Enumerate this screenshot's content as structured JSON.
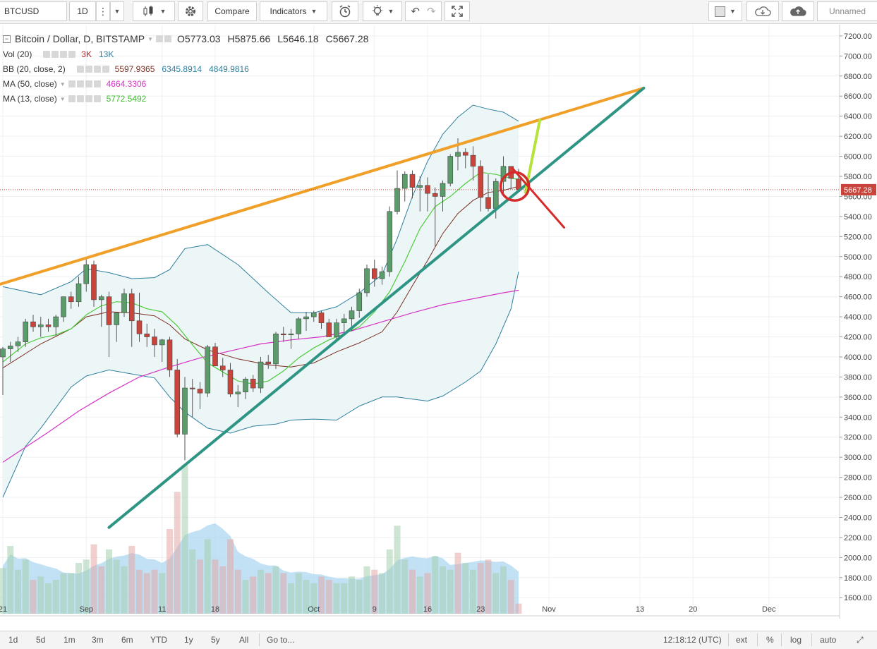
{
  "toolbar": {
    "symbol": "BTCUSD",
    "interval": "1D",
    "compare_label": "Compare",
    "indicators_label": "Indicators",
    "layout_name": "Unnamed",
    "icons": [
      "menu-dots-icon",
      "candles-icon",
      "gear-icon",
      "alert-clock-icon",
      "bulb-icon",
      "undo-icon",
      "redo-icon",
      "fullscreen-icon",
      "square-icon",
      "cloud-download-icon",
      "cloud-upload-icon"
    ]
  },
  "legend": {
    "title": "Bitcoin / Dollar, D, BITSTAMP",
    "ohlc": {
      "o": "O5773.03",
      "h": "H5875.66",
      "l": "L5646.18",
      "c": "C5667.28"
    },
    "vol": {
      "name": "Vol (20)",
      "v1": "3K",
      "v2": "13K"
    },
    "bb": {
      "name": "BB (20, close, 2)",
      "basis": "5597.9365",
      "upper": "6345.8914",
      "lower": "4849.9816"
    },
    "ma50": {
      "name": "MA (50, close)",
      "value": "4664.3306"
    },
    "ma13": {
      "name": "MA (13, close)",
      "value": "5772.5492"
    }
  },
  "colors": {
    "up": "#5b9c6b",
    "down": "#c9453c",
    "bb_line": "#2f7f9e",
    "bb_fill": "#eaf4f4",
    "ma50": "#d633c6",
    "ma13": "#4ccc3a",
    "basis": "#7a2e22",
    "orange_line": "#f0a028",
    "teal_line": "#2e9585",
    "lime_line": "#b5e33a",
    "marker": "#d62a2a",
    "last_price_tag": "#c9453c"
  },
  "chart_data": {
    "type": "candlestick",
    "title": "Bitcoin / Dollar, D, BITSTAMP",
    "ylim": [
      1420,
      7300
    ],
    "y_ticks": [
      "7200.00",
      "7000.00",
      "6800.00",
      "6600.00",
      "6400.00",
      "6200.00",
      "6000.00",
      "5800.00",
      "5600.00",
      "5400.00",
      "5200.00",
      "5000.00",
      "4800.00",
      "4600.00",
      "4400.00",
      "4200.00",
      "4000.00",
      "3800.00",
      "3600.00",
      "3400.00",
      "3200.00",
      "3000.00",
      "2800.00",
      "2600.00",
      "2400.00",
      "2200.00",
      "2000.00",
      "1800.00",
      "1600.00"
    ],
    "x_ticks": [
      {
        "label": "21",
        "day": 0
      },
      {
        "label": "Sep",
        "day": 11
      },
      {
        "label": "11",
        "day": 21
      },
      {
        "label": "18",
        "day": 28
      },
      {
        "label": "Oct",
        "day": 41
      },
      {
        "label": "9",
        "day": 49
      },
      {
        "label": "16",
        "day": 56
      },
      {
        "label": "23",
        "day": 63
      },
      {
        "label": "Nov",
        "day": 72
      },
      {
        "label": "13",
        "day": 84
      },
      {
        "label": "20",
        "day": 91
      },
      {
        "label": "Dec",
        "day": 101
      }
    ],
    "last_price": "5667.28",
    "last_price_value": 5667.28,
    "candles": [
      [
        4000,
        4100,
        3620,
        4080
      ],
      [
        4080,
        4150,
        3950,
        4110
      ],
      [
        4110,
        4200,
        4050,
        4150
      ],
      [
        4150,
        4380,
        4100,
        4350
      ],
      [
        4350,
        4420,
        4250,
        4300
      ],
      [
        4300,
        4400,
        4200,
        4320
      ],
      [
        4320,
        4380,
        4250,
        4300
      ],
      [
        4300,
        4420,
        4200,
        4400
      ],
      [
        4400,
        4600,
        4350,
        4600
      ],
      [
        4600,
        4650,
        4480,
        4550
      ],
      [
        4550,
        4800,
        4500,
        4730
      ],
      [
        4730,
        4990,
        4650,
        4920
      ],
      [
        4920,
        4960,
        4500,
        4570
      ],
      [
        4570,
        4620,
        4300,
        4600
      ],
      [
        4600,
        4650,
        4000,
        4320
      ],
      [
        4320,
        4450,
        4150,
        4440
      ],
      [
        4440,
        4680,
        4400,
        4630
      ],
      [
        4630,
        4680,
        4100,
        4360
      ],
      [
        4360,
        4640,
        4150,
        4230
      ],
      [
        4230,
        4330,
        4100,
        4200
      ],
      [
        4200,
        4280,
        4000,
        4120
      ],
      [
        4120,
        4180,
        3950,
        4170
      ],
      [
        4170,
        4200,
        3800,
        3870
      ],
      [
        3870,
        3980,
        3200,
        3230
      ],
      [
        3230,
        3800,
        2970,
        3690
      ],
      [
        3690,
        3780,
        3400,
        3680
      ],
      [
        3680,
        3750,
        3480,
        3640
      ],
      [
        3640,
        4120,
        3600,
        4100
      ],
      [
        4100,
        4140,
        3920,
        3910
      ],
      [
        3910,
        3990,
        3800,
        3870
      ],
      [
        3870,
        3940,
        3600,
        3630
      ],
      [
        3630,
        3720,
        3500,
        3650
      ],
      [
        3650,
        3800,
        3580,
        3780
      ],
      [
        3780,
        3820,
        3650,
        3690
      ],
      [
        3690,
        4000,
        3640,
        3950
      ],
      [
        3950,
        4020,
        3880,
        3930
      ],
      [
        3930,
        4250,
        3880,
        4230
      ],
      [
        4230,
        4300,
        4150,
        4220
      ],
      [
        4220,
        4280,
        4080,
        4230
      ],
      [
        4230,
        4400,
        4180,
        4380
      ],
      [
        4380,
        4450,
        4260,
        4400
      ],
      [
        4400,
        4460,
        4350,
        4440
      ],
      [
        4440,
        4460,
        4280,
        4340
      ],
      [
        4340,
        4380,
        4200,
        4200
      ],
      [
        4200,
        4380,
        4150,
        4340
      ],
      [
        4340,
        4430,
        4250,
        4380
      ],
      [
        4380,
        4500,
        4260,
        4460
      ],
      [
        4460,
        4680,
        4390,
        4640
      ],
      [
        4640,
        4920,
        4600,
        4880
      ],
      [
        4880,
        4970,
        4700,
        4780
      ],
      [
        4780,
        4900,
        4720,
        4850
      ],
      [
        4850,
        5500,
        4800,
        5450
      ],
      [
        5450,
        5860,
        5420,
        5680
      ],
      [
        5680,
        5850,
        5550,
        5820
      ],
      [
        5820,
        5860,
        5580,
        5690
      ],
      [
        5690,
        5800,
        5450,
        5710
      ],
      [
        5710,
        5790,
        5450,
        5630
      ],
      [
        5630,
        5690,
        5100,
        5600
      ],
      [
        5600,
        5760,
        5450,
        5730
      ],
      [
        5730,
        6020,
        5700,
        6000
      ],
      [
        6000,
        6180,
        5860,
        6040
      ],
      [
        6040,
        6080,
        5880,
        6010
      ],
      [
        6010,
        6100,
        5760,
        5900
      ],
      [
        5900,
        5960,
        5450,
        5590
      ],
      [
        5590,
        5820,
        5450,
        5480
      ],
      [
        5480,
        5780,
        5380,
        5750
      ],
      [
        5750,
        6000,
        5620,
        5900
      ],
      [
        5900,
        5900,
        5670,
        5780
      ],
      [
        5773.03,
        5875.66,
        5646.18,
        5667.28
      ]
    ],
    "volumes": [
      [
        1.35,
        "up"
      ],
      [
        2.0,
        "up"
      ],
      [
        1.3,
        "up"
      ],
      [
        1.6,
        "up"
      ],
      [
        1.0,
        "down"
      ],
      [
        1.1,
        "up"
      ],
      [
        0.9,
        "up"
      ],
      [
        1.0,
        "up"
      ],
      [
        1.2,
        "up"
      ],
      [
        1.2,
        "up"
      ],
      [
        1.5,
        "up"
      ],
      [
        1.6,
        "up"
      ],
      [
        2.05,
        "down"
      ],
      [
        1.4,
        "down"
      ],
      [
        1.9,
        "up"
      ],
      [
        1.6,
        "up"
      ],
      [
        1.4,
        "up"
      ],
      [
        2.0,
        "down"
      ],
      [
        1.3,
        "down"
      ],
      [
        1.2,
        "down"
      ],
      [
        1.3,
        "down"
      ],
      [
        1.2,
        "up"
      ],
      [
        2.5,
        "down"
      ],
      [
        3.6,
        "down"
      ],
      [
        4.4,
        "up"
      ],
      [
        1.9,
        "up"
      ],
      [
        1.6,
        "down"
      ],
      [
        2.2,
        "up"
      ],
      [
        1.6,
        "down"
      ],
      [
        1.4,
        "down"
      ],
      [
        2.2,
        "down"
      ],
      [
        1.3,
        "down"
      ],
      [
        1.0,
        "up"
      ],
      [
        1.1,
        "down"
      ],
      [
        1.3,
        "up"
      ],
      [
        1.2,
        "down"
      ],
      [
        1.4,
        "up"
      ],
      [
        1.2,
        "down"
      ],
      [
        0.9,
        "up"
      ],
      [
        1.2,
        "up"
      ],
      [
        1.0,
        "up"
      ],
      [
        0.9,
        "up"
      ],
      [
        1.1,
        "down"
      ],
      [
        1.0,
        "down"
      ],
      [
        0.9,
        "up"
      ],
      [
        0.9,
        "up"
      ],
      [
        1.1,
        "up"
      ],
      [
        1.0,
        "up"
      ],
      [
        1.4,
        "up"
      ],
      [
        1.3,
        "down"
      ],
      [
        1.2,
        "up"
      ],
      [
        1.9,
        "up"
      ],
      [
        2.6,
        "up"
      ],
      [
        1.6,
        "up"
      ],
      [
        1.3,
        "down"
      ],
      [
        1.1,
        "up"
      ],
      [
        1.2,
        "down"
      ],
      [
        1.7,
        "up"
      ],
      [
        1.4,
        "up"
      ],
      [
        1.3,
        "up"
      ],
      [
        1.8,
        "down"
      ],
      [
        1.5,
        "up"
      ],
      [
        1.3,
        "up"
      ],
      [
        1.5,
        "down"
      ],
      [
        1.6,
        "down"
      ],
      [
        1.2,
        "up"
      ],
      [
        1.4,
        "up"
      ],
      [
        1.0,
        "down"
      ],
      [
        0.3,
        "down"
      ]
    ],
    "bollinger": {
      "upper": [
        [
          0,
          4700
        ],
        [
          5,
          4620
        ],
        [
          9,
          4750
        ],
        [
          11,
          4880
        ],
        [
          14,
          4840
        ],
        [
          17,
          4780
        ],
        [
          20,
          4790
        ],
        [
          22,
          4870
        ],
        [
          24,
          5080
        ],
        [
          27,
          5120
        ],
        [
          31,
          4920
        ],
        [
          35,
          4640
        ],
        [
          38,
          4440
        ],
        [
          41,
          4440
        ],
        [
          44,
          4500
        ],
        [
          47,
          4640
        ],
        [
          50,
          4820
        ],
        [
          52,
          5180
        ],
        [
          54,
          5600
        ],
        [
          56,
          5950
        ],
        [
          58,
          6220
        ],
        [
          60,
          6390
        ],
        [
          62,
          6510
        ],
        [
          64,
          6470
        ],
        [
          66,
          6440
        ],
        [
          68,
          6350
        ]
      ],
      "basis": [
        [
          0,
          3890
        ],
        [
          5,
          4130
        ],
        [
          9,
          4280
        ],
        [
          11,
          4400
        ],
        [
          14,
          4450
        ],
        [
          17,
          4440
        ],
        [
          20,
          4410
        ],
        [
          22,
          4320
        ],
        [
          24,
          4180
        ],
        [
          27,
          4070
        ],
        [
          31,
          3980
        ],
        [
          35,
          3920
        ],
        [
          38,
          3900
        ],
        [
          41,
          3940
        ],
        [
          44,
          4050
        ],
        [
          47,
          4140
        ],
        [
          50,
          4250
        ],
        [
          52,
          4450
        ],
        [
          54,
          4710
        ],
        [
          56,
          4960
        ],
        [
          58,
          5230
        ],
        [
          60,
          5430
        ],
        [
          62,
          5560
        ],
        [
          64,
          5640
        ],
        [
          66,
          5660
        ],
        [
          68,
          5700
        ]
      ],
      "lower": [
        [
          0,
          2600
        ],
        [
          3,
          3110
        ],
        [
          5,
          3290
        ],
        [
          9,
          3700
        ],
        [
          11,
          3810
        ],
        [
          14,
          3870
        ],
        [
          17,
          3830
        ],
        [
          20,
          3790
        ],
        [
          22,
          3600
        ],
        [
          24,
          3450
        ],
        [
          27,
          3290
        ],
        [
          30,
          3240
        ],
        [
          33,
          3310
        ],
        [
          36,
          3330
        ],
        [
          38,
          3370
        ],
        [
          41,
          3380
        ],
        [
          44,
          3370
        ],
        [
          47,
          3510
        ],
        [
          50,
          3600
        ],
        [
          52,
          3600
        ],
        [
          54,
          3580
        ],
        [
          56,
          3560
        ],
        [
          58,
          3610
        ],
        [
          61,
          3750
        ],
        [
          63,
          3860
        ],
        [
          65,
          4130
        ],
        [
          67,
          4480
        ],
        [
          68,
          4850
        ]
      ]
    },
    "ma13": [
      [
        0,
        3950
      ],
      [
        3,
        4130
      ],
      [
        5,
        4190
      ],
      [
        7,
        4220
      ],
      [
        9,
        4280
      ],
      [
        11,
        4420
      ],
      [
        13,
        4510
      ],
      [
        15,
        4550
      ],
      [
        17,
        4540
      ],
      [
        19,
        4480
      ],
      [
        21,
        4450
      ],
      [
        23,
        4310
      ],
      [
        25,
        4120
      ],
      [
        27,
        3940
      ],
      [
        29,
        3850
      ],
      [
        31,
        3760
      ],
      [
        33,
        3730
      ],
      [
        35,
        3760
      ],
      [
        37,
        3860
      ],
      [
        39,
        3990
      ],
      [
        41,
        4090
      ],
      [
        43,
        4170
      ],
      [
        45,
        4230
      ],
      [
        47,
        4300
      ],
      [
        49,
        4450
      ],
      [
        51,
        4650
      ],
      [
        53,
        4950
      ],
      [
        55,
        5280
      ],
      [
        57,
        5500
      ],
      [
        59,
        5600
      ],
      [
        61,
        5730
      ],
      [
        63,
        5840
      ],
      [
        65,
        5820
      ],
      [
        67,
        5780
      ],
      [
        68,
        5772
      ]
    ],
    "ma50": [
      [
        0,
        2950
      ],
      [
        6,
        3250
      ],
      [
        10,
        3460
      ],
      [
        14,
        3640
      ],
      [
        18,
        3800
      ],
      [
        22,
        3900
      ],
      [
        26,
        3990
      ],
      [
        30,
        4060
      ],
      [
        34,
        4130
      ],
      [
        38,
        4170
      ],
      [
        42,
        4200
      ],
      [
        46,
        4260
      ],
      [
        50,
        4350
      ],
      [
        54,
        4440
      ],
      [
        58,
        4520
      ],
      [
        62,
        4580
      ],
      [
        66,
        4640
      ],
      [
        68,
        4664
      ]
    ],
    "trendlines": [
      {
        "name": "orange-channel-line",
        "from": [
          -1,
          4710
        ],
        "to": [
          84.5,
          6680
        ]
      },
      {
        "name": "teal-support-line",
        "from": [
          14,
          2300
        ],
        "to": [
          84.5,
          6680
        ]
      },
      {
        "name": "lime-projection-line",
        "from": [
          68.9,
          5640
        ],
        "to": [
          70.8,
          6360
        ]
      },
      {
        "name": "red-down-arrow-line",
        "from": [
          67.2,
          5880
        ],
        "to": [
          74,
          5290
        ]
      }
    ],
    "marker": {
      "day": 67.5,
      "value": 5700
    }
  }
}
